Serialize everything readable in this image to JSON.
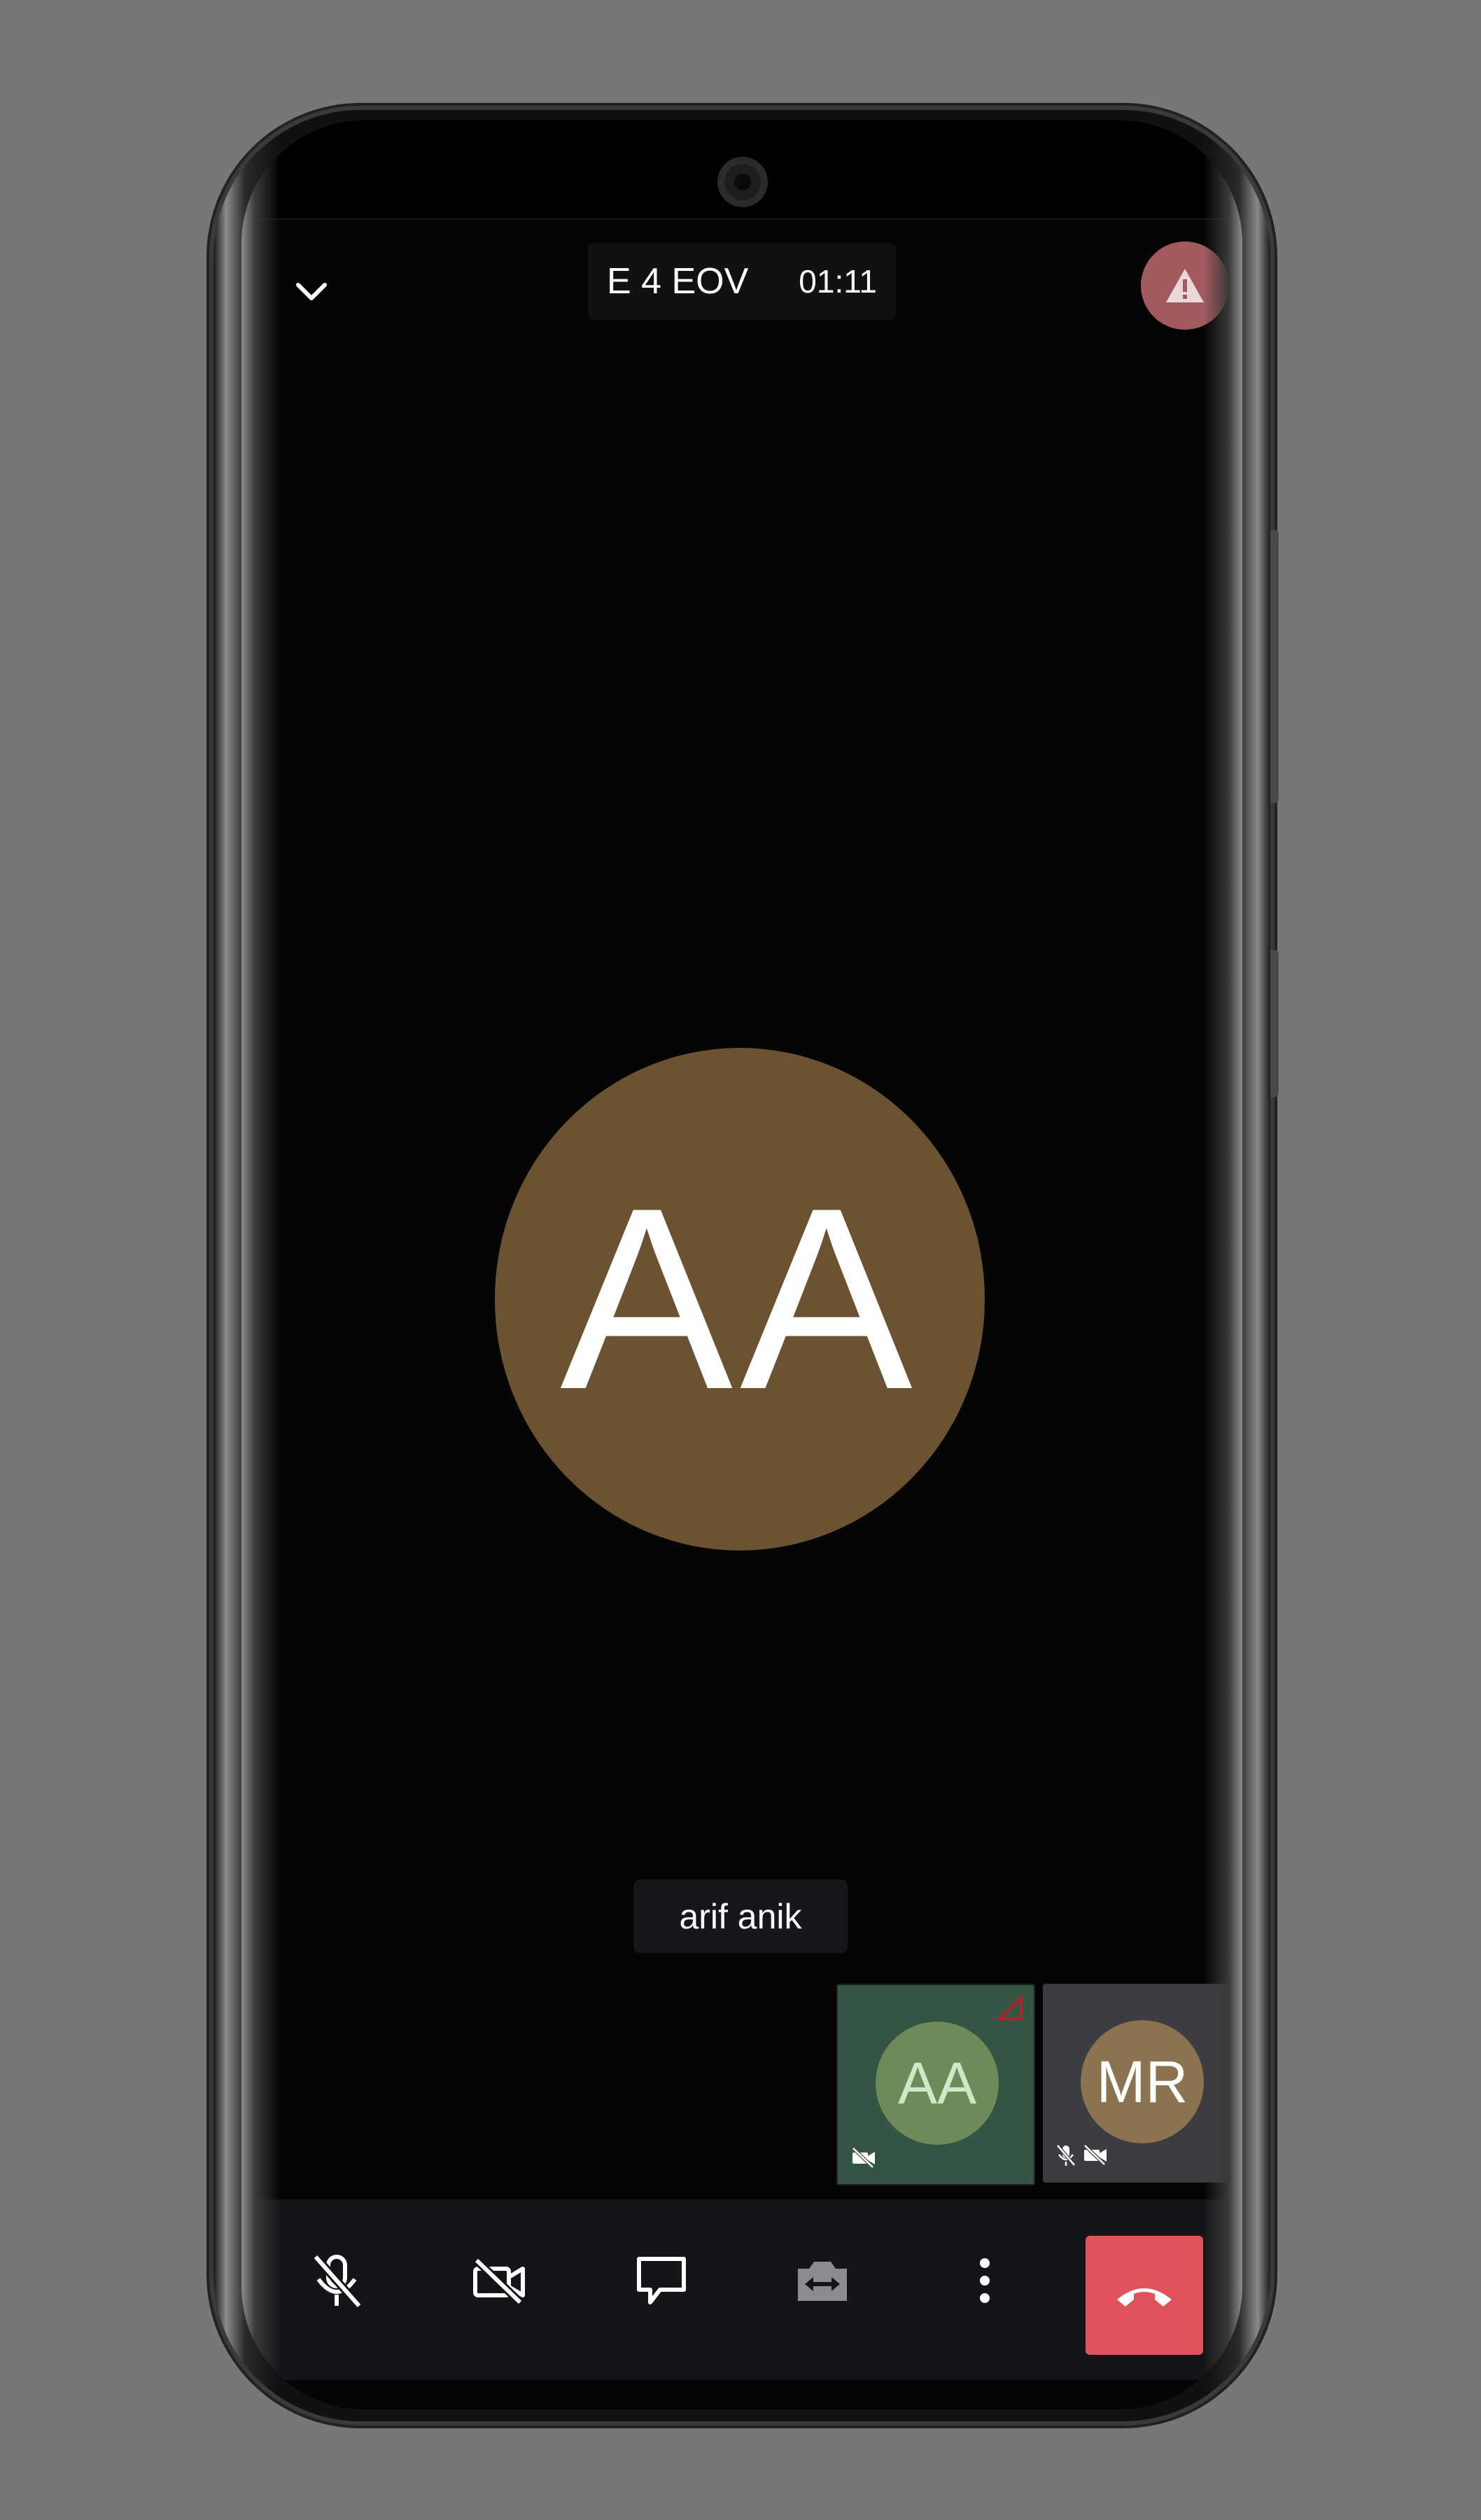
{
  "call": {
    "meeting_name": "E 4 EOV",
    "timer": "01:11"
  },
  "main_participant": {
    "initials": "AA",
    "name": "arif anik",
    "avatar_color": "#6b5332"
  },
  "thumbnails": [
    {
      "initials": "AA",
      "avatar_color": "#6e8a58",
      "tile_color": "#345444",
      "icons": [
        "video-off-icon"
      ],
      "corner_icon": "signal-warning-icon"
    },
    {
      "initials": "MR",
      "avatar_color": "#8c7350",
      "tile_color": "#3c3d42",
      "icons": [
        "mic-off-icon",
        "video-off-icon"
      ]
    }
  ],
  "toolbar": {
    "buttons": [
      "mic-off-icon",
      "video-off-icon",
      "chat-icon",
      "switch-camera-icon",
      "more-icon",
      "hangup-icon"
    ],
    "hangup_color": "#e2525b"
  },
  "colors": {
    "background": "#050505",
    "alert": "#a35a5e"
  }
}
